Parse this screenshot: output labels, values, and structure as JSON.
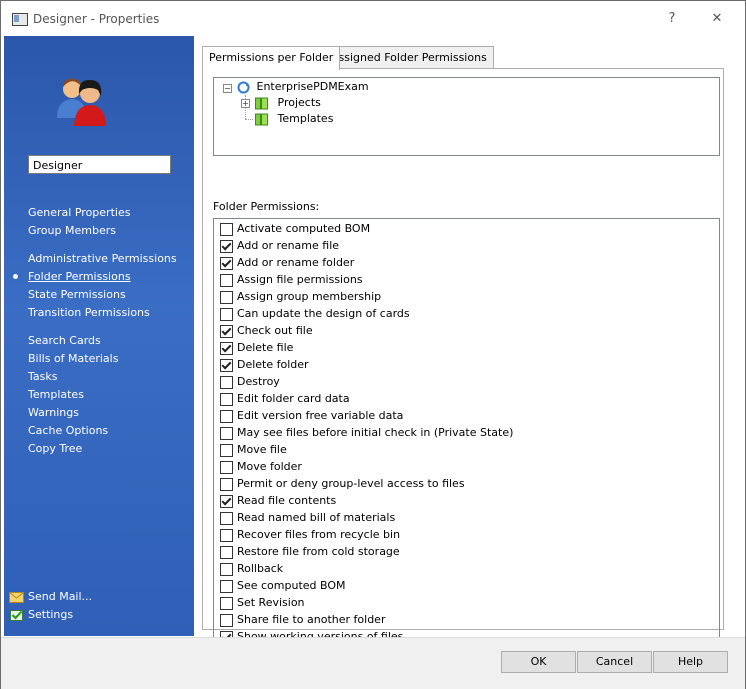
{
  "window": {
    "title": "Designer - Properties",
    "help_glyph": "?",
    "close_glyph": "✕"
  },
  "sidebar": {
    "name_value": "Designer",
    "groups": [
      {
        "items": [
          {
            "label": "General Properties"
          },
          {
            "label": "Group Members"
          }
        ]
      },
      {
        "items": [
          {
            "label": "Administrative Permissions"
          },
          {
            "label": "Folder Permissions",
            "active": true
          },
          {
            "label": "State Permissions"
          },
          {
            "label": "Transition Permissions"
          }
        ]
      },
      {
        "items": [
          {
            "label": "Search Cards"
          },
          {
            "label": "Bills of Materials"
          },
          {
            "label": "Tasks"
          },
          {
            "label": "Templates"
          },
          {
            "label": "Warnings"
          },
          {
            "label": "Cache Options"
          },
          {
            "label": "Copy Tree"
          }
        ]
      }
    ],
    "send_mail": "Send Mail...",
    "settings": "Settings"
  },
  "tabs": [
    {
      "label": "Permissions per Folder",
      "selected": true
    },
    {
      "label": "Assigned Folder Permissions",
      "selected": false
    }
  ],
  "tree": {
    "root": "EnterprisePDMExam",
    "children": [
      {
        "label": "Projects",
        "expandable": true
      },
      {
        "label": "Templates",
        "expandable": false
      }
    ]
  },
  "folder_permissions_label": "Folder Permissions:",
  "permissions": [
    {
      "label": "Activate computed BOM",
      "checked": false
    },
    {
      "label": "Add or rename file",
      "checked": true
    },
    {
      "label": "Add or rename folder",
      "checked": true
    },
    {
      "label": "Assign file permissions",
      "checked": false
    },
    {
      "label": "Assign group membership",
      "checked": false
    },
    {
      "label": "Can update the design of cards",
      "checked": false
    },
    {
      "label": "Check out file",
      "checked": true
    },
    {
      "label": "Delete file",
      "checked": true
    },
    {
      "label": "Delete folder",
      "checked": true
    },
    {
      "label": "Destroy",
      "checked": false
    },
    {
      "label": "Edit folder card data",
      "checked": false
    },
    {
      "label": "Edit version free variable data",
      "checked": false
    },
    {
      "label": "May see files before initial check in (Private State)",
      "checked": false
    },
    {
      "label": "Move file",
      "checked": false
    },
    {
      "label": "Move folder",
      "checked": false
    },
    {
      "label": "Permit or deny group-level access to files",
      "checked": false
    },
    {
      "label": "Read file contents",
      "checked": true
    },
    {
      "label": "Read named bill of materials",
      "checked": false
    },
    {
      "label": "Recover files from recycle bin",
      "checked": false
    },
    {
      "label": "Restore file from cold storage",
      "checked": false
    },
    {
      "label": "Rollback",
      "checked": false
    },
    {
      "label": "See computed BOM",
      "checked": false
    },
    {
      "label": "Set Revision",
      "checked": false
    },
    {
      "label": "Share file to another folder",
      "checked": false
    },
    {
      "label": "Show working versions of files",
      "checked": true
    }
  ],
  "buttons": {
    "ok": "OK",
    "cancel": "Cancel",
    "help": "Help"
  }
}
